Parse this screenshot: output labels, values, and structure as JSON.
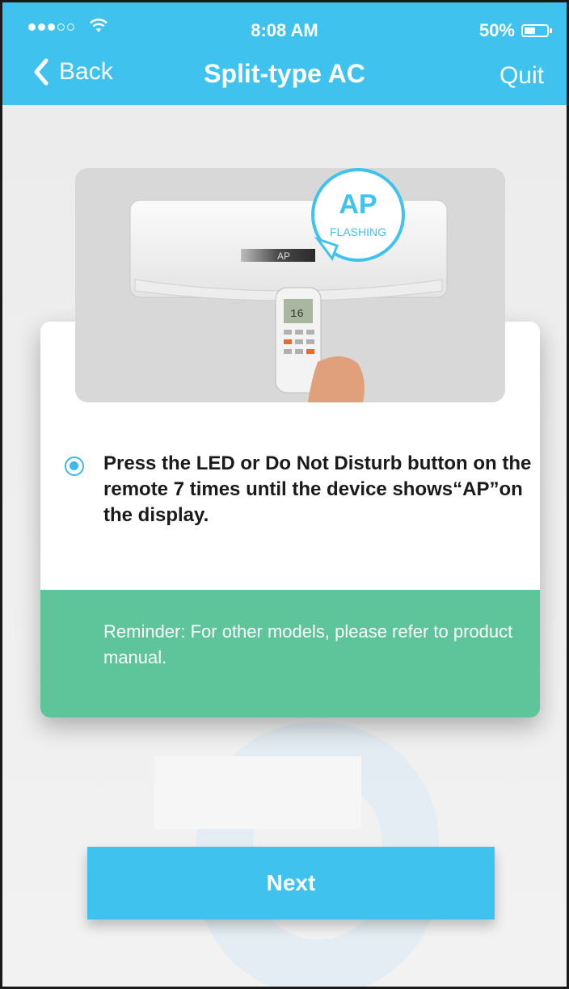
{
  "status_bar": {
    "time": "8:08 AM",
    "battery_percent": "50%",
    "signal_filled_dots": 3,
    "signal_total_dots": 5,
    "battery_level": 0.5
  },
  "nav": {
    "back_label": "Back",
    "title": "Split-type AC",
    "quit_label": "Quit"
  },
  "illustration": {
    "bubble_main": "AP",
    "bubble_sub": "FLASHING",
    "display_text": "AP",
    "remote_display": "16"
  },
  "instruction": {
    "text": "Press the LED or Do Not Disturb button on the remote 7 times until the device shows“AP”on the display.",
    "selected": true
  },
  "reminder": {
    "text": "Reminder: For other models, please refer to product manual."
  },
  "footer": {
    "next_label": "Next"
  },
  "colors": {
    "accent": "#3fc3ee",
    "reminder": "#5ec59a",
    "radio": "#3bb8ec"
  }
}
